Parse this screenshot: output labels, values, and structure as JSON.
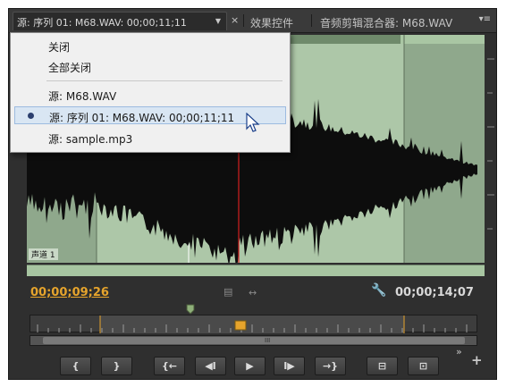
{
  "tabs": {
    "source_tab_label": "源: 序列 01: M68.WAV: 00;00;11;11",
    "source_tab_dropdown": "▼",
    "close_glyph": "×",
    "effects_tab_label": "效果控件",
    "audio_mixer_tab_label": "音频剪辑混合器: M68.WAV",
    "panel_menu_glyph": "▾≡"
  },
  "dropdown_menu": {
    "items": [
      {
        "label": "关闭"
      },
      {
        "label": "全部关闭"
      },
      {
        "label": "源: M68.WAV"
      },
      {
        "label": "源: 序列 01: M68.WAV: 00;00;11;11",
        "selected": true
      },
      {
        "label": "源: sample.mp3"
      }
    ]
  },
  "waveform": {
    "track_label": "声道 1",
    "background_color": "#9fb59d",
    "selection_color": "#adc7a8",
    "playhead_color": "#d42020"
  },
  "timecode": {
    "current": "00;00;09;26",
    "duration": "00;00;14;07",
    "current_color": "#e6a42c"
  },
  "transport": {
    "buttons": [
      {
        "name": "mark-in",
        "glyph": "{"
      },
      {
        "name": "mark-out",
        "glyph": "}"
      },
      {
        "name": "go-to-in",
        "glyph": "{←"
      },
      {
        "name": "step-back",
        "glyph": "◀I"
      },
      {
        "name": "play",
        "glyph": "▶"
      },
      {
        "name": "step-forward",
        "glyph": "I▶"
      },
      {
        "name": "go-to-out",
        "glyph": "→}"
      },
      {
        "name": "insert",
        "glyph": "⊟"
      },
      {
        "name": "overwrite",
        "glyph": "⊡"
      }
    ],
    "more_glyph": "»",
    "add_glyph": "+"
  }
}
